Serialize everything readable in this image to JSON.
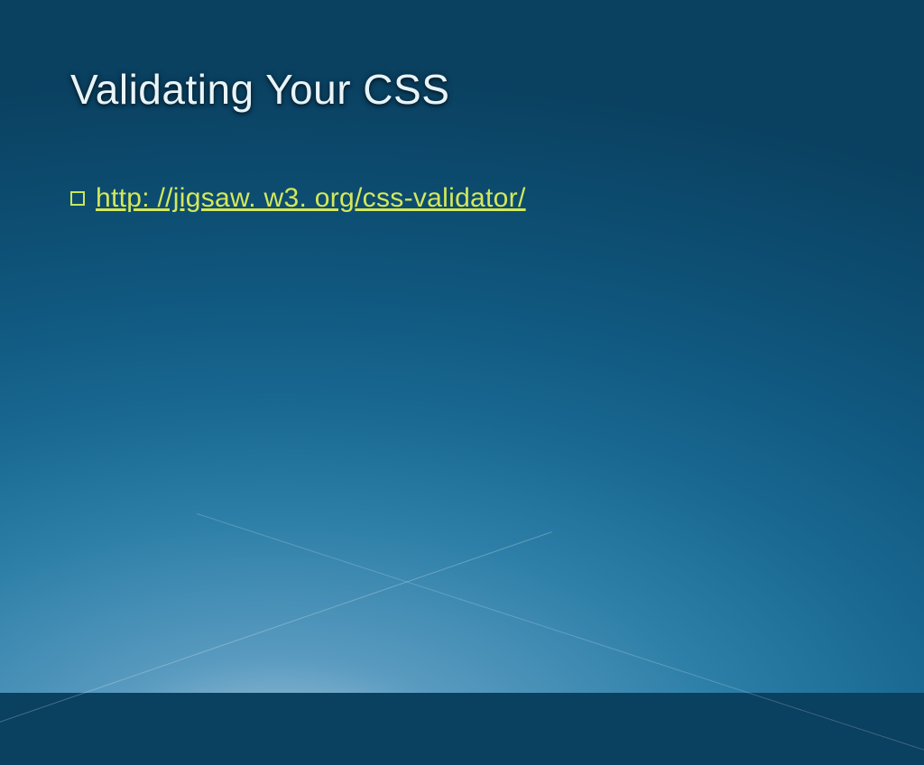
{
  "slide": {
    "title": "Validating Your CSS",
    "bullet": {
      "link_text": "http: //jigsaw. w3. org/css-validator/"
    }
  }
}
